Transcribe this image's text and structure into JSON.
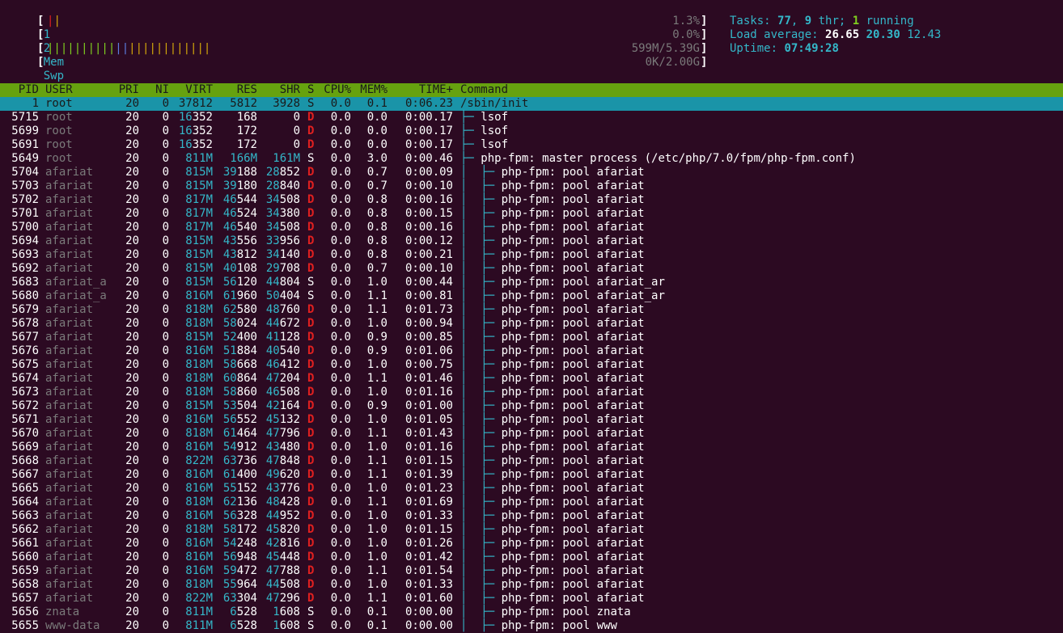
{
  "meters": {
    "cpu1": {
      "label": "1",
      "open": "[",
      "value": "1.3%",
      "close": "]"
    },
    "cpu2": {
      "label": "2",
      "open": "[",
      "value": "0.0%",
      "close": "]"
    },
    "mem": {
      "label": "Mem",
      "open": "[",
      "bars": "||||||||||||||||||||||||",
      "value": "599M/5.39G",
      "close": "]"
    },
    "swp": {
      "label": "Swp",
      "open": "[",
      "value": "0K/2.00G",
      "close": "]"
    }
  },
  "summary": {
    "tasks_label": "Tasks: ",
    "tasks": "77",
    "comma": ", ",
    "threads": "9",
    "thr_label": " thr; ",
    "running": "1",
    "running_label": " running",
    "load_label": "Load average: ",
    "load1": "26.65",
    "load5": "20.30",
    "load15": "12.43",
    "uptime_label": "Uptime: ",
    "uptime": "07:49:28"
  },
  "columns": {
    "pid": "PID",
    "user": "USER",
    "pri": "PRI",
    "ni": "NI",
    "virt": "VIRT",
    "res": "RES",
    "shr": "SHR",
    "s": "S",
    "cpu": "CPU%",
    "mem": "MEM%",
    "time": "TIME+",
    "command": "Command"
  },
  "processes": [
    {
      "pid": "1",
      "user": "root",
      "pri": "20",
      "ni": "0",
      "virt": "37812",
      "res": "5812",
      "shr": "3928",
      "s": "S",
      "cpu": "0.0",
      "mem": "0.1",
      "time": "0:06.23",
      "tree": "",
      "command": "/sbin/init",
      "selected": true
    },
    {
      "pid": "5715",
      "user": "root",
      "pri": "20",
      "ni": "0",
      "virt": "16352",
      "res": "168",
      "shr": "0",
      "s": "D",
      "cpu": "0.0",
      "mem": "0.0",
      "time": "0:00.17",
      "tree": "├─ ",
      "command": "lsof"
    },
    {
      "pid": "5699",
      "user": "root",
      "pri": "20",
      "ni": "0",
      "virt": "16352",
      "res": "172",
      "shr": "0",
      "s": "D",
      "cpu": "0.0",
      "mem": "0.0",
      "time": "0:00.17",
      "tree": "├─ ",
      "command": "lsof"
    },
    {
      "pid": "5691",
      "user": "root",
      "pri": "20",
      "ni": "0",
      "virt": "16352",
      "res": "172",
      "shr": "0",
      "s": "D",
      "cpu": "0.0",
      "mem": "0.0",
      "time": "0:00.17",
      "tree": "├─ ",
      "command": "lsof"
    },
    {
      "pid": "5649",
      "user": "root",
      "pri": "20",
      "ni": "0",
      "virt": "811M",
      "res": "166M",
      "shr": "161M",
      "s": "S",
      "cpu": "0.0",
      "mem": "3.0",
      "time": "0:00.46",
      "tree": "├─ ",
      "command": "php-fpm: master process (/etc/php/7.0/fpm/php-fpm.conf)"
    },
    {
      "pid": "5704",
      "user": "afariat",
      "pri": "20",
      "ni": "0",
      "virt": "815M",
      "res": "39188",
      "shr": "28852",
      "s": "D",
      "cpu": "0.0",
      "mem": "0.7",
      "time": "0:00.09",
      "tree": "│  ├─ ",
      "command": "php-fpm: pool afariat"
    },
    {
      "pid": "5703",
      "user": "afariat",
      "pri": "20",
      "ni": "0",
      "virt": "815M",
      "res": "39180",
      "shr": "28840",
      "s": "D",
      "cpu": "0.0",
      "mem": "0.7",
      "time": "0:00.10",
      "tree": "│  ├─ ",
      "command": "php-fpm: pool afariat"
    },
    {
      "pid": "5702",
      "user": "afariat",
      "pri": "20",
      "ni": "0",
      "virt": "817M",
      "res": "46544",
      "shr": "34508",
      "s": "D",
      "cpu": "0.0",
      "mem": "0.8",
      "time": "0:00.16",
      "tree": "│  ├─ ",
      "command": "php-fpm: pool afariat"
    },
    {
      "pid": "5701",
      "user": "afariat",
      "pri": "20",
      "ni": "0",
      "virt": "817M",
      "res": "46524",
      "shr": "34380",
      "s": "D",
      "cpu": "0.0",
      "mem": "0.8",
      "time": "0:00.15",
      "tree": "│  ├─ ",
      "command": "php-fpm: pool afariat"
    },
    {
      "pid": "5700",
      "user": "afariat",
      "pri": "20",
      "ni": "0",
      "virt": "817M",
      "res": "46540",
      "shr": "34508",
      "s": "D",
      "cpu": "0.0",
      "mem": "0.8",
      "time": "0:00.16",
      "tree": "│  ├─ ",
      "command": "php-fpm: pool afariat"
    },
    {
      "pid": "5694",
      "user": "afariat",
      "pri": "20",
      "ni": "0",
      "virt": "815M",
      "res": "43556",
      "shr": "33956",
      "s": "D",
      "cpu": "0.0",
      "mem": "0.8",
      "time": "0:00.12",
      "tree": "│  ├─ ",
      "command": "php-fpm: pool afariat"
    },
    {
      "pid": "5693",
      "user": "afariat",
      "pri": "20",
      "ni": "0",
      "virt": "815M",
      "res": "43812",
      "shr": "34140",
      "s": "D",
      "cpu": "0.0",
      "mem": "0.8",
      "time": "0:00.21",
      "tree": "│  ├─ ",
      "command": "php-fpm: pool afariat"
    },
    {
      "pid": "5692",
      "user": "afariat",
      "pri": "20",
      "ni": "0",
      "virt": "815M",
      "res": "40108",
      "shr": "29708",
      "s": "D",
      "cpu": "0.0",
      "mem": "0.7",
      "time": "0:00.10",
      "tree": "│  ├─ ",
      "command": "php-fpm: pool afariat"
    },
    {
      "pid": "5683",
      "user": "afariat_a",
      "pri": "20",
      "ni": "0",
      "virt": "815M",
      "res": "56120",
      "shr": "44804",
      "s": "S",
      "cpu": "0.0",
      "mem": "1.0",
      "time": "0:00.44",
      "tree": "│  ├─ ",
      "command": "php-fpm: pool afariat_ar"
    },
    {
      "pid": "5680",
      "user": "afariat_a",
      "pri": "20",
      "ni": "0",
      "virt": "816M",
      "res": "61960",
      "shr": "50404",
      "s": "S",
      "cpu": "0.0",
      "mem": "1.1",
      "time": "0:00.81",
      "tree": "│  ├─ ",
      "command": "php-fpm: pool afariat_ar"
    },
    {
      "pid": "5679",
      "user": "afariat",
      "pri": "20",
      "ni": "0",
      "virt": "818M",
      "res": "62580",
      "shr": "48760",
      "s": "D",
      "cpu": "0.0",
      "mem": "1.1",
      "time": "0:01.73",
      "tree": "│  ├─ ",
      "command": "php-fpm: pool afariat"
    },
    {
      "pid": "5678",
      "user": "afariat",
      "pri": "20",
      "ni": "0",
      "virt": "818M",
      "res": "58024",
      "shr": "44672",
      "s": "D",
      "cpu": "0.0",
      "mem": "1.0",
      "time": "0:00.94",
      "tree": "│  ├─ ",
      "command": "php-fpm: pool afariat"
    },
    {
      "pid": "5677",
      "user": "afariat",
      "pri": "20",
      "ni": "0",
      "virt": "815M",
      "res": "52400",
      "shr": "41128",
      "s": "D",
      "cpu": "0.0",
      "mem": "0.9",
      "time": "0:00.85",
      "tree": "│  ├─ ",
      "command": "php-fpm: pool afariat"
    },
    {
      "pid": "5676",
      "user": "afariat",
      "pri": "20",
      "ni": "0",
      "virt": "816M",
      "res": "51884",
      "shr": "40540",
      "s": "D",
      "cpu": "0.0",
      "mem": "0.9",
      "time": "0:01.06",
      "tree": "│  ├─ ",
      "command": "php-fpm: pool afariat"
    },
    {
      "pid": "5675",
      "user": "afariat",
      "pri": "20",
      "ni": "0",
      "virt": "818M",
      "res": "58668",
      "shr": "46412",
      "s": "D",
      "cpu": "0.0",
      "mem": "1.0",
      "time": "0:00.75",
      "tree": "│  ├─ ",
      "command": "php-fpm: pool afariat"
    },
    {
      "pid": "5674",
      "user": "afariat",
      "pri": "20",
      "ni": "0",
      "virt": "818M",
      "res": "60864",
      "shr": "47204",
      "s": "D",
      "cpu": "0.0",
      "mem": "1.1",
      "time": "0:01.46",
      "tree": "│  ├─ ",
      "command": "php-fpm: pool afariat"
    },
    {
      "pid": "5673",
      "user": "afariat",
      "pri": "20",
      "ni": "0",
      "virt": "818M",
      "res": "58860",
      "shr": "46508",
      "s": "D",
      "cpu": "0.0",
      "mem": "1.0",
      "time": "0:01.16",
      "tree": "│  ├─ ",
      "command": "php-fpm: pool afariat"
    },
    {
      "pid": "5672",
      "user": "afariat",
      "pri": "20",
      "ni": "0",
      "virt": "815M",
      "res": "53504",
      "shr": "42164",
      "s": "D",
      "cpu": "0.0",
      "mem": "0.9",
      "time": "0:01.00",
      "tree": "│  ├─ ",
      "command": "php-fpm: pool afariat"
    },
    {
      "pid": "5671",
      "user": "afariat",
      "pri": "20",
      "ni": "0",
      "virt": "816M",
      "res": "56552",
      "shr": "45132",
      "s": "D",
      "cpu": "0.0",
      "mem": "1.0",
      "time": "0:01.05",
      "tree": "│  ├─ ",
      "command": "php-fpm: pool afariat"
    },
    {
      "pid": "5670",
      "user": "afariat",
      "pri": "20",
      "ni": "0",
      "virt": "818M",
      "res": "61464",
      "shr": "47796",
      "s": "D",
      "cpu": "0.0",
      "mem": "1.1",
      "time": "0:01.43",
      "tree": "│  ├─ ",
      "command": "php-fpm: pool afariat"
    },
    {
      "pid": "5669",
      "user": "afariat",
      "pri": "20",
      "ni": "0",
      "virt": "816M",
      "res": "54912",
      "shr": "43480",
      "s": "D",
      "cpu": "0.0",
      "mem": "1.0",
      "time": "0:01.16",
      "tree": "│  ├─ ",
      "command": "php-fpm: pool afariat"
    },
    {
      "pid": "5668",
      "user": "afariat",
      "pri": "20",
      "ni": "0",
      "virt": "822M",
      "res": "63736",
      "shr": "47848",
      "s": "D",
      "cpu": "0.0",
      "mem": "1.1",
      "time": "0:01.15",
      "tree": "│  ├─ ",
      "command": "php-fpm: pool afariat"
    },
    {
      "pid": "5667",
      "user": "afariat",
      "pri": "20",
      "ni": "0",
      "virt": "816M",
      "res": "61400",
      "shr": "49620",
      "s": "D",
      "cpu": "0.0",
      "mem": "1.1",
      "time": "0:01.39",
      "tree": "│  ├─ ",
      "command": "php-fpm: pool afariat"
    },
    {
      "pid": "5665",
      "user": "afariat",
      "pri": "20",
      "ni": "0",
      "virt": "816M",
      "res": "55152",
      "shr": "43776",
      "s": "D",
      "cpu": "0.0",
      "mem": "1.0",
      "time": "0:01.23",
      "tree": "│  ├─ ",
      "command": "php-fpm: pool afariat"
    },
    {
      "pid": "5664",
      "user": "afariat",
      "pri": "20",
      "ni": "0",
      "virt": "818M",
      "res": "62136",
      "shr": "48428",
      "s": "D",
      "cpu": "0.0",
      "mem": "1.1",
      "time": "0:01.69",
      "tree": "│  ├─ ",
      "command": "php-fpm: pool afariat"
    },
    {
      "pid": "5663",
      "user": "afariat",
      "pri": "20",
      "ni": "0",
      "virt": "816M",
      "res": "56328",
      "shr": "44952",
      "s": "D",
      "cpu": "0.0",
      "mem": "1.0",
      "time": "0:01.33",
      "tree": "│  ├─ ",
      "command": "php-fpm: pool afariat"
    },
    {
      "pid": "5662",
      "user": "afariat",
      "pri": "20",
      "ni": "0",
      "virt": "818M",
      "res": "58172",
      "shr": "45820",
      "s": "D",
      "cpu": "0.0",
      "mem": "1.0",
      "time": "0:01.15",
      "tree": "│  ├─ ",
      "command": "php-fpm: pool afariat"
    },
    {
      "pid": "5661",
      "user": "afariat",
      "pri": "20",
      "ni": "0",
      "virt": "816M",
      "res": "54248",
      "shr": "42816",
      "s": "D",
      "cpu": "0.0",
      "mem": "1.0",
      "time": "0:01.26",
      "tree": "│  ├─ ",
      "command": "php-fpm: pool afariat"
    },
    {
      "pid": "5660",
      "user": "afariat",
      "pri": "20",
      "ni": "0",
      "virt": "816M",
      "res": "56948",
      "shr": "45448",
      "s": "D",
      "cpu": "0.0",
      "mem": "1.0",
      "time": "0:01.42",
      "tree": "│  ├─ ",
      "command": "php-fpm: pool afariat"
    },
    {
      "pid": "5659",
      "user": "afariat",
      "pri": "20",
      "ni": "0",
      "virt": "816M",
      "res": "59472",
      "shr": "47788",
      "s": "D",
      "cpu": "0.0",
      "mem": "1.1",
      "time": "0:01.54",
      "tree": "│  ├─ ",
      "command": "php-fpm: pool afariat"
    },
    {
      "pid": "5658",
      "user": "afariat",
      "pri": "20",
      "ni": "0",
      "virt": "818M",
      "res": "55964",
      "shr": "44508",
      "s": "D",
      "cpu": "0.0",
      "mem": "1.0",
      "time": "0:01.33",
      "tree": "│  ├─ ",
      "command": "php-fpm: pool afariat"
    },
    {
      "pid": "5657",
      "user": "afariat",
      "pri": "20",
      "ni": "0",
      "virt": "822M",
      "res": "63304",
      "shr": "47296",
      "s": "D",
      "cpu": "0.0",
      "mem": "1.1",
      "time": "0:01.60",
      "tree": "│  ├─ ",
      "command": "php-fpm: pool afariat"
    },
    {
      "pid": "5656",
      "user": "znata",
      "pri": "20",
      "ni": "0",
      "virt": "811M",
      "res": "6528",
      "shr": "1608",
      "s": "S",
      "cpu": "0.0",
      "mem": "0.1",
      "time": "0:00.00",
      "tree": "│  ├─ ",
      "command": "php-fpm: pool znata"
    },
    {
      "pid": "5655",
      "user": "www-data",
      "pri": "20",
      "ni": "0",
      "virt": "811M",
      "res": "6528",
      "shr": "1608",
      "s": "S",
      "cpu": "0.0",
      "mem": "0.1",
      "time": "0:00.00",
      "tree": "│  ├─ ",
      "command": "php-fpm: pool www"
    }
  ],
  "colors": {
    "background": "#2c0a22",
    "header": "#66a20f",
    "selected_row": "#1a94a8",
    "accent_cyan": "#34b7c9",
    "state_d": "#e02020"
  }
}
